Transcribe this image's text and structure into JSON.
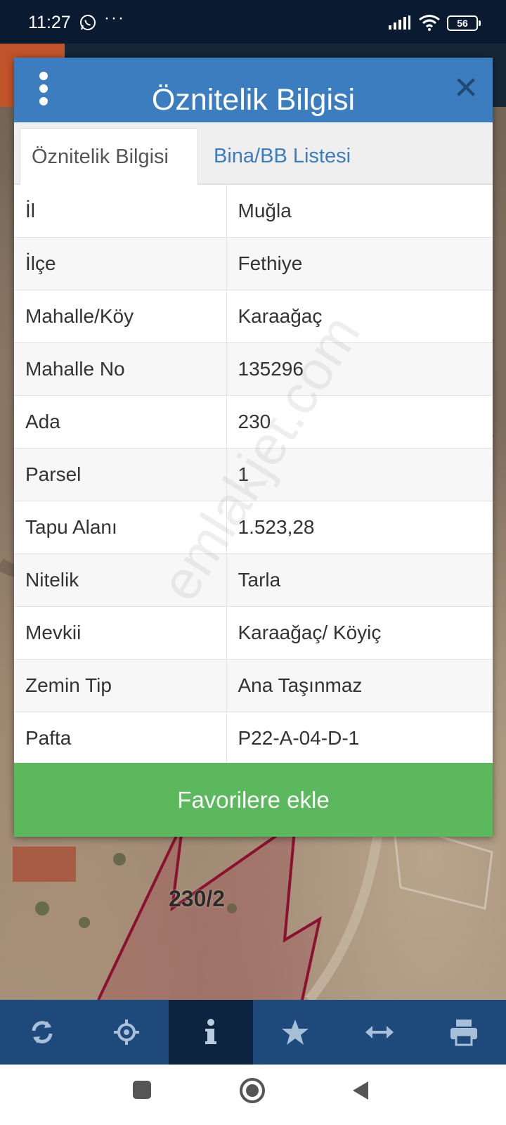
{
  "status_bar": {
    "time": "11:27",
    "notification_overflow": "···",
    "battery": "56"
  },
  "map": {
    "parcel_label": "230/2"
  },
  "dialog": {
    "title": "Öznitelik Bilgisi",
    "close_icon": "close-icon",
    "tabs": [
      {
        "label": "Öznitelik Bilgisi",
        "active": true
      },
      {
        "label": "Bina/BB Listesi",
        "active": false
      }
    ],
    "rows": [
      {
        "key": "İl",
        "value": "Muğla"
      },
      {
        "key": "İlçe",
        "value": "Fethiye"
      },
      {
        "key": "Mahalle/Köy",
        "value": "Karaağaç"
      },
      {
        "key": "Mahalle No",
        "value": "135296"
      },
      {
        "key": "Ada",
        "value": "230"
      },
      {
        "key": "Parsel",
        "value": "1"
      },
      {
        "key": "Tapu Alanı",
        "value": "1.523,28"
      },
      {
        "key": "Nitelik",
        "value": "Tarla"
      },
      {
        "key": "Mevkii",
        "value": "Karaağaç/ Köyiç"
      },
      {
        "key": "Zemin Tip",
        "value": "Ana Taşınmaz"
      },
      {
        "key": "Pafta",
        "value": "P22-A-04-D-1"
      }
    ],
    "favorite_button": "Favorilere ekle",
    "watermark": "emlakjet.com"
  },
  "toolbar": {
    "items": [
      "refresh-icon",
      "locate-icon",
      "info-icon",
      "star-icon",
      "measure-icon",
      "print-icon"
    ],
    "active": "info-icon"
  },
  "colors": {
    "header_blue": "#3b7dbe",
    "button_green": "#5cb85c",
    "toolbar_blue": "#1d4a7a",
    "parcel_line": "#8a1230"
  }
}
